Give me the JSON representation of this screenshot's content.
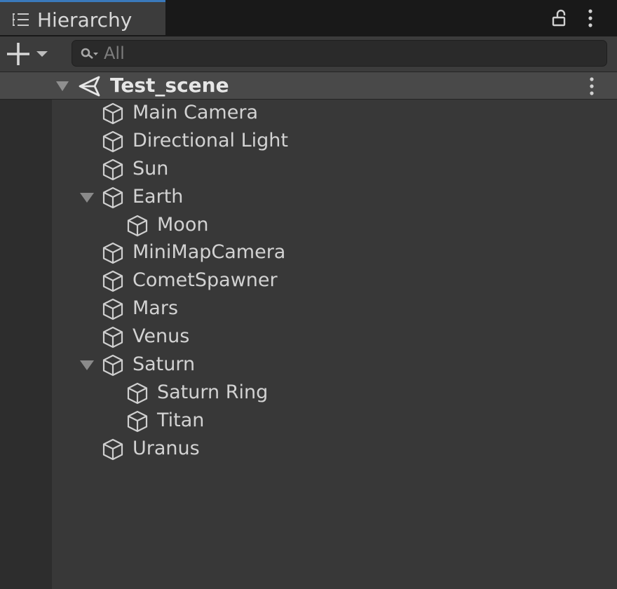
{
  "window": {
    "tab_label": "Hierarchy"
  },
  "toolbar": {
    "search_placeholder": "All"
  },
  "scene": {
    "name": "Test_scene",
    "expanded": true
  },
  "tree": {
    "items": [
      {
        "label": "Main Camera",
        "depth": 0,
        "expandable": false
      },
      {
        "label": "Directional Light",
        "depth": 0,
        "expandable": false
      },
      {
        "label": "Sun",
        "depth": 0,
        "expandable": false
      },
      {
        "label": "Earth",
        "depth": 0,
        "expandable": true,
        "expanded": true
      },
      {
        "label": "Moon",
        "depth": 1,
        "expandable": false
      },
      {
        "label": "MiniMapCamera",
        "depth": 0,
        "expandable": false
      },
      {
        "label": "CometSpawner",
        "depth": 0,
        "expandable": false
      },
      {
        "label": "Mars",
        "depth": 0,
        "expandable": false
      },
      {
        "label": "Venus",
        "depth": 0,
        "expandable": false
      },
      {
        "label": "Saturn",
        "depth": 0,
        "expandable": true,
        "expanded": true
      },
      {
        "label": "Saturn Ring",
        "depth": 1,
        "expandable": false
      },
      {
        "label": "Titan",
        "depth": 1,
        "expandable": false
      },
      {
        "label": "Uranus",
        "depth": 0,
        "expandable": false
      }
    ]
  },
  "colors": {
    "accent": "#3a79bb",
    "panel_bg": "#383838",
    "scene_row_bg": "#494949"
  },
  "icons": {
    "tab": "hierarchy-list-icon",
    "lock": "lock-icon",
    "menu": "kebab-menu-icon",
    "add": "plus-icon",
    "search": "search-icon",
    "scene": "unity-scene-icon",
    "object": "gameobject-cube-icon",
    "expand": "triangle-down-icon"
  }
}
